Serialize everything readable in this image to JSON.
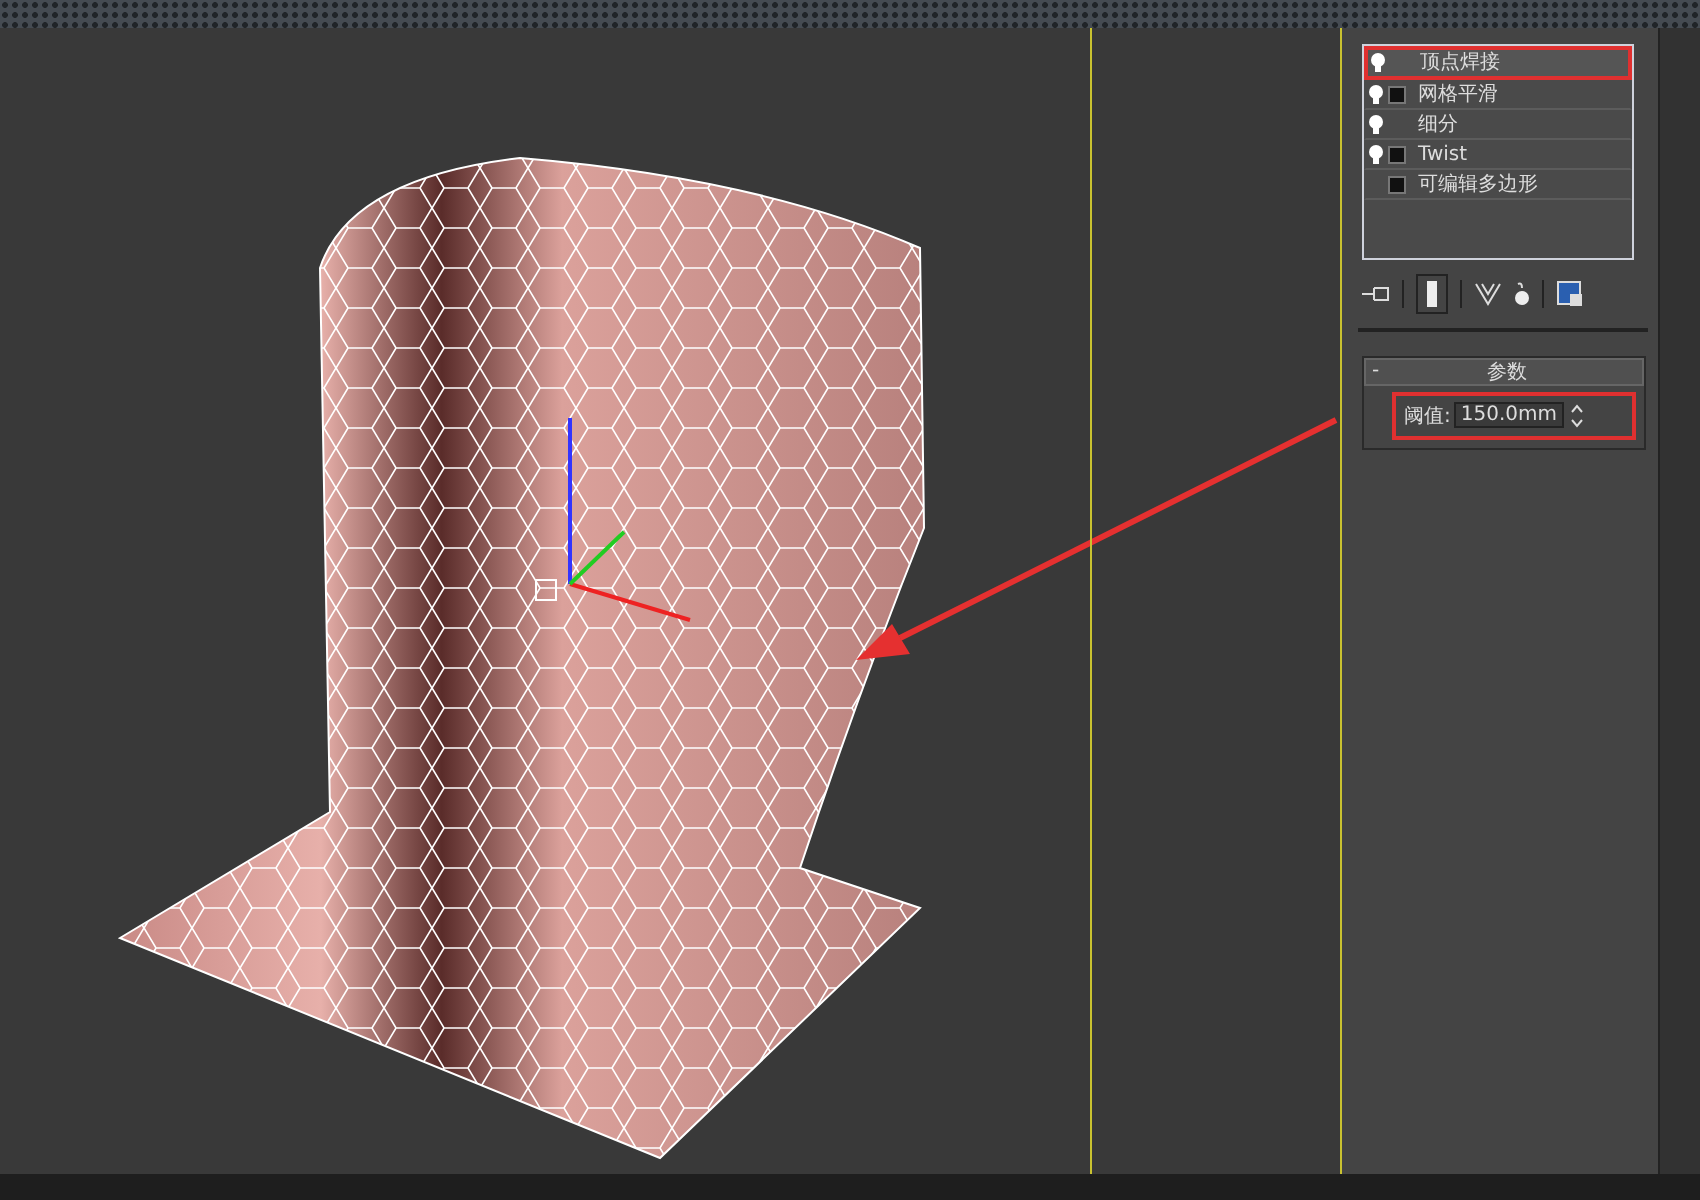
{
  "modifier_stack": [
    {
      "label": "顶点焊接",
      "bulb": true,
      "expandable": false,
      "selected": true
    },
    {
      "label": "网格平滑",
      "bulb": true,
      "expandable": true,
      "selected": false
    },
    {
      "label": "细分",
      "bulb": true,
      "expandable": false,
      "selected": false
    },
    {
      "label": "Twist",
      "bulb": true,
      "expandable": true,
      "selected": false
    },
    {
      "label": "可编辑多边形",
      "bulb": false,
      "expandable": true,
      "selected": false
    }
  ],
  "rollout": {
    "toggle": "-",
    "title": "参数",
    "field": {
      "label": "阈值:",
      "value": "150.0mm"
    }
  }
}
